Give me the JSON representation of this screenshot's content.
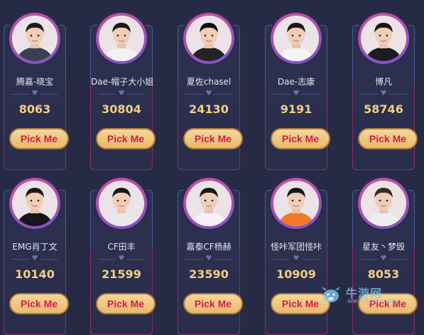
{
  "button_label": "Pick Me",
  "heart_glyph": "♥",
  "players": [
    {
      "name": "腾嘉-晓宝",
      "votes": "8063",
      "shirt": "#3a3f52",
      "hair": "#1e1a1a"
    },
    {
      "name": "Dae-帽子大小姐",
      "votes": "30804",
      "shirt": "#f2f2f2",
      "hair": "#1b1717"
    },
    {
      "name": "夏佐chasel",
      "votes": "24130",
      "shirt": "#222227",
      "hair": "#121010"
    },
    {
      "name": "Dae-志康",
      "votes": "9191",
      "shirt": "#f4f4f4",
      "hair": "#1a1616"
    },
    {
      "name": "博凡",
      "votes": "58746",
      "shirt": "#1c1c24",
      "hair": "#1a1616"
    },
    {
      "name": "EMG肖丁文",
      "votes": "10140",
      "shirt": "#15151b",
      "hair": "#1d1919"
    },
    {
      "name": "CF田丰",
      "votes": "21599",
      "shirt": "#e9e9ec",
      "hair": "#1a1717"
    },
    {
      "name": "嘉泰CF杨赫",
      "votes": "23590",
      "shirt": "#f3f3f5",
      "hair": "#1c1818"
    },
    {
      "name": "怪咔军团怪咔",
      "votes": "10909",
      "shirt": "#f07a2a",
      "hair": "#171414"
    },
    {
      "name": "星友丶梦毁",
      "votes": "8053",
      "shirt": "#eeeeee",
      "hair": "#3a2a22"
    }
  ],
  "watermark": {
    "cn": "牛游网",
    "url": "www.newyx.net",
    "accent": "#6cb8ea"
  }
}
